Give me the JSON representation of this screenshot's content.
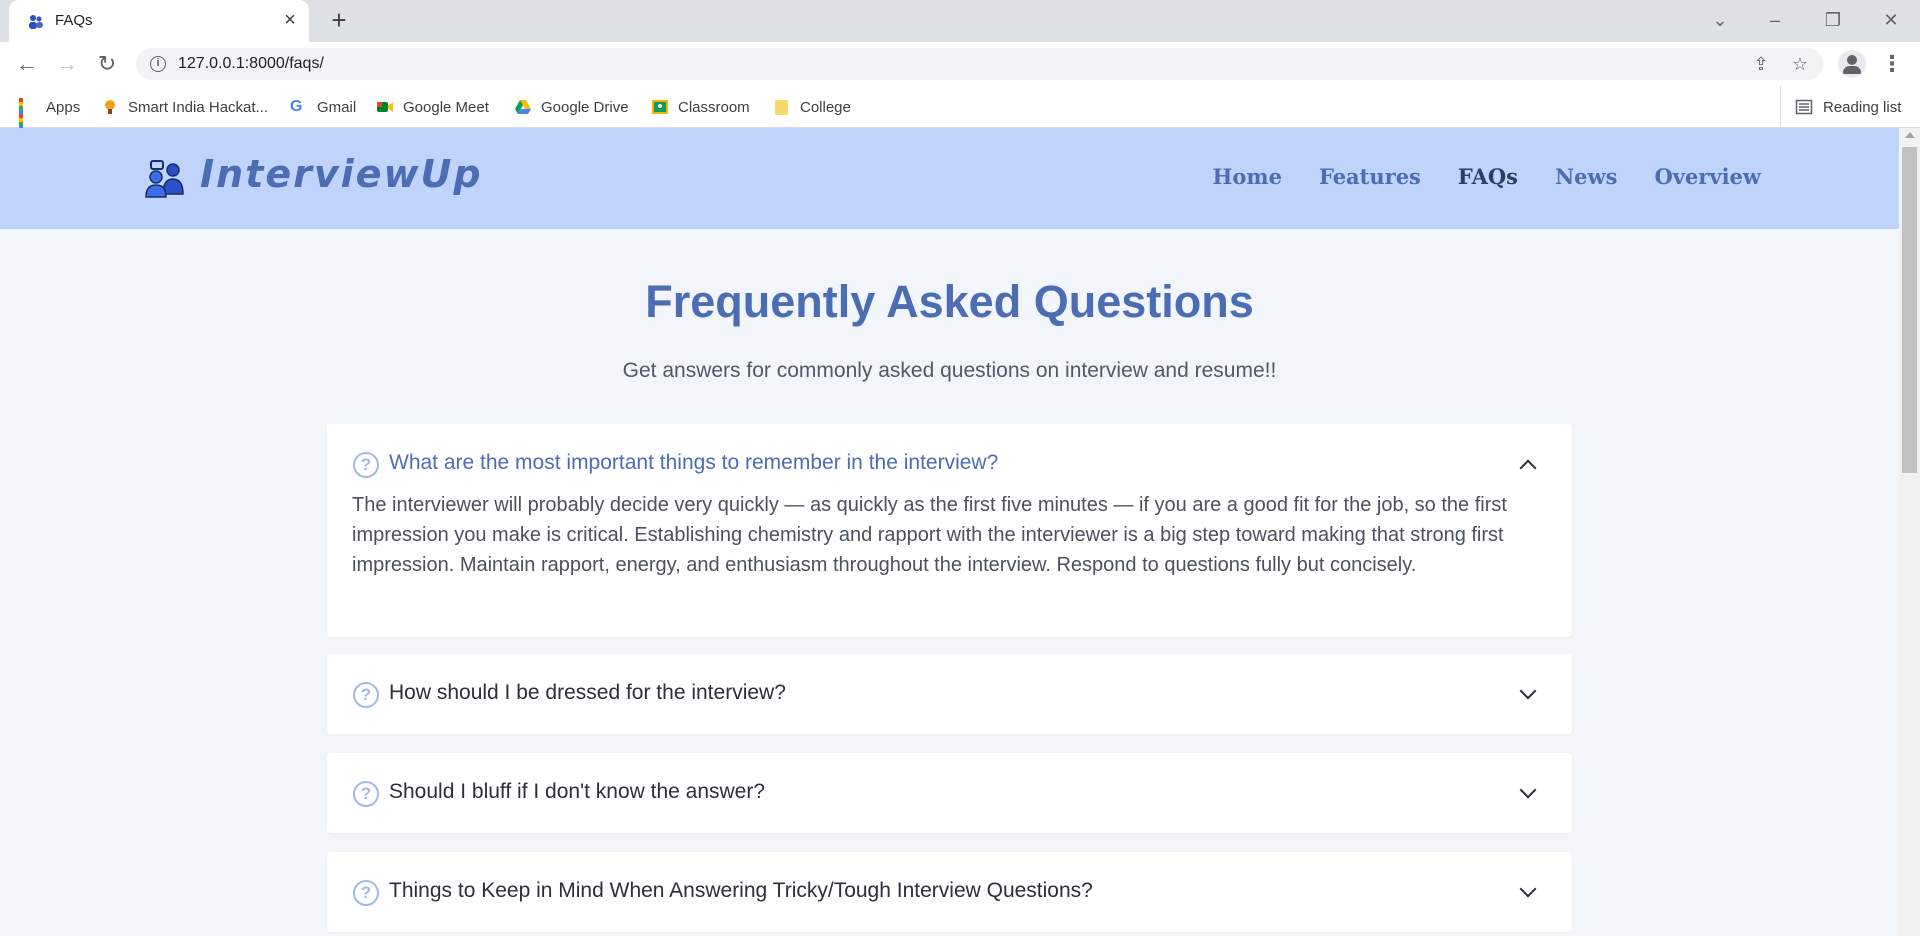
{
  "browser": {
    "tab_title": "FAQs",
    "url": "127.0.0.1:8000/faqs/",
    "bookmarks": [
      {
        "label": "Apps",
        "icon": "apps-grid-icon"
      },
      {
        "label": "Smart India Hackat...",
        "icon": "bulb-icon"
      },
      {
        "label": "Gmail",
        "icon": "google-icon"
      },
      {
        "label": "Google Meet",
        "icon": "meet-icon"
      },
      {
        "label": "Google Drive",
        "icon": "drive-icon"
      },
      {
        "label": "Classroom",
        "icon": "classroom-icon"
      },
      {
        "label": "College",
        "icon": "folder-icon"
      }
    ],
    "reading_list": "Reading list"
  },
  "site": {
    "brand": "InterviewUp",
    "nav": [
      "Home",
      "Features",
      "FAQs",
      "News",
      "Overview"
    ],
    "active_nav": "FAQs",
    "colors": {
      "header_bg": "#c0d3fb",
      "accent": "#4c6db4",
      "active_nav": "#2b3e63"
    }
  },
  "page": {
    "title": "Frequently Asked Questions",
    "subtitle": "Get answers for commonly asked questions on interview and resume!!"
  },
  "faqs": [
    {
      "question": "What are the most important things to remember in the interview?",
      "expanded": true,
      "answer": "The interviewer will probably decide very quickly — as quickly as the first five minutes — if you are a good fit for the job, so the first impression you make is critical. Establishing chemistry and rapport with the interviewer is a big step toward making that strong first impression. Maintain rapport, energy, and enthusiasm throughout the interview. Respond to questions fully but concisely."
    },
    {
      "question": "How should I be dressed for the interview?",
      "expanded": false
    },
    {
      "question": "Should I bluff if I don't know the answer?",
      "expanded": false
    },
    {
      "question": "Things to Keep in Mind When Answering Tricky/Tough Interview Questions?",
      "expanded": false
    }
  ]
}
